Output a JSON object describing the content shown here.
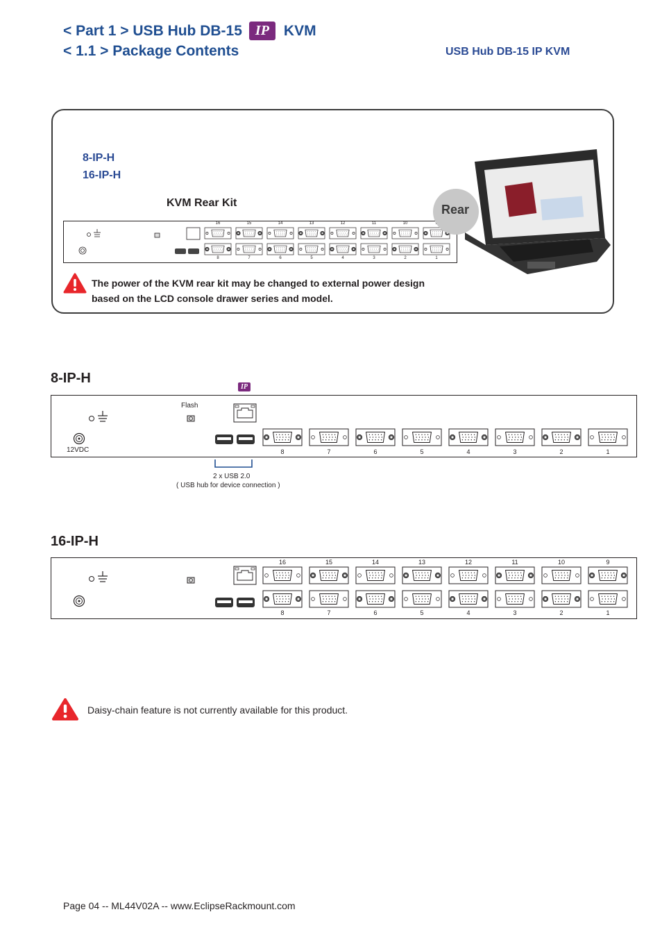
{
  "header": {
    "title_prefix": "< Part 1 >  USB Hub  DB-15",
    "title_badge": "IP",
    "title_suffix": "KVM",
    "section_title": "< 1.1 > Package Contents",
    "right_subtitle": "USB Hub  DB-15 IP KVM"
  },
  "package_panel": {
    "models": [
      "8-IP-H",
      "16-IP-H"
    ],
    "kit_title": "KVM Rear Kit",
    "rear_label": "Rear",
    "kit_top_ports": [
      "16",
      "15",
      "14",
      "13",
      "12",
      "11",
      "10",
      "9"
    ],
    "kit_bottom_ports": [
      "8",
      "7",
      "6",
      "5",
      "4",
      "3",
      "2",
      "1"
    ],
    "warning_line1": "The power of the KVM rear kit may be changed to external power design",
    "warning_line2": "based on the LCD console drawer series and model.",
    "product_image": "lcd-console-drawer-photo"
  },
  "model_8": {
    "title": "8-IP-H",
    "ip_badge": "IP",
    "flash_label": "Flash",
    "power_label": "12VDC",
    "ports": [
      "8",
      "7",
      "6",
      "5",
      "4",
      "3",
      "2",
      "1"
    ],
    "usb_caption_line1": "2 x USB 2.0",
    "usb_caption_line2": "( USB hub for device connection )"
  },
  "model_16": {
    "title": "16-IP-H",
    "top_ports": [
      "16",
      "15",
      "14",
      "13",
      "12",
      "11",
      "10",
      "9"
    ],
    "bottom_ports": [
      "8",
      "7",
      "6",
      "5",
      "4",
      "3",
      "2",
      "1"
    ]
  },
  "notice": {
    "text": "Daisy-chain feature is not currently available for this product."
  },
  "footer": {
    "text": "Page 04 -- ML44V02A -- www.EclipseRackmount.com"
  },
  "colors": {
    "heading_blue": "#1f4e91",
    "label_blue": "#2a4a94",
    "ip_purple": "#7b2a7e",
    "warning_red": "#e8262b"
  }
}
